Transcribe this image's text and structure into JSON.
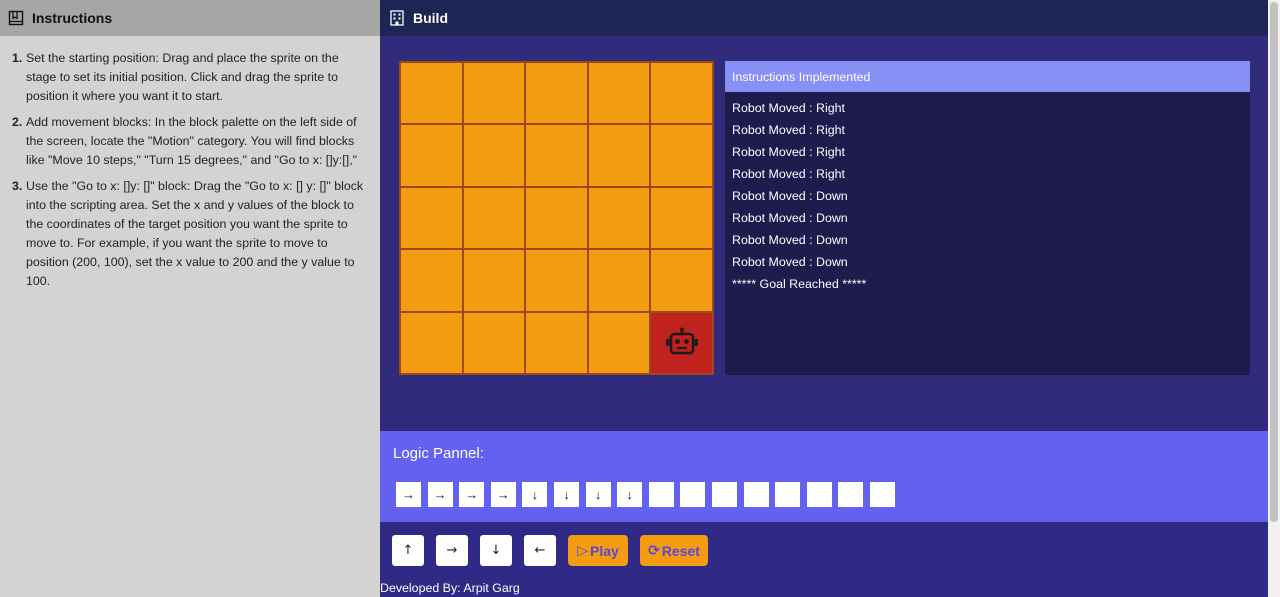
{
  "left": {
    "title": "Instructions",
    "icon": "book-icon",
    "items": [
      {
        "num": "1.",
        "text": "Set the starting position: Drag and place the sprite on the stage to set its initial position. Click and drag the sprite to position it where you want it to start."
      },
      {
        "num": "2.",
        "text": "Add movement blocks: In the block palette on the left side of the screen, locate the \"Motion\" category. You will find blocks like \"Move 10 steps,\" \"Turn 15 degrees,\" and \"Go to x: []y:[],\""
      },
      {
        "num": "3.",
        "text": "Use the \"Go to x: []y: []\" block: Drag the \"Go to x: [] y: []\" block into the scripting area. Set the x and y values of the block to the coordinates of the target position you want the sprite to move to. For example, if you want the sprite to move to position (200, 100), set the x value to 200 and the y value to 100."
      }
    ]
  },
  "build": {
    "title": "Build",
    "icon": "building-icon"
  },
  "grid": {
    "rows": 5,
    "cols": 5,
    "robot_row": 4,
    "robot_col": 4,
    "cell_color": "#f39c12",
    "goal_color": "#c0221e",
    "robot_icon": "robot-icon"
  },
  "log": {
    "title": "Instructions Implemented",
    "lines": [
      "Robot Moved : Right",
      "Robot Moved : Right",
      "Robot Moved : Right",
      "Robot Moved : Right",
      "Robot Moved : Down",
      "Robot Moved : Down",
      "Robot Moved : Down",
      "Robot Moved : Down",
      "***** Goal Reached *****"
    ]
  },
  "logic": {
    "title": "Logic Pannel:",
    "slots": [
      "→",
      "→",
      "→",
      "→",
      "↓",
      "↓",
      "↓",
      "↓",
      "",
      "",
      "",
      "",
      "",
      "",
      "",
      ""
    ]
  },
  "controls": {
    "up": "↑",
    "right": "→",
    "down": "↓",
    "left": "←",
    "play_icon": "▷",
    "play_label": "Play",
    "reset_icon": "⟳",
    "reset_label": "Reset"
  },
  "footer": "Developed By: Arpit Garg",
  "colors": {
    "accent": "#6361ef",
    "header": "#1c2554",
    "button": "#f39c12"
  }
}
